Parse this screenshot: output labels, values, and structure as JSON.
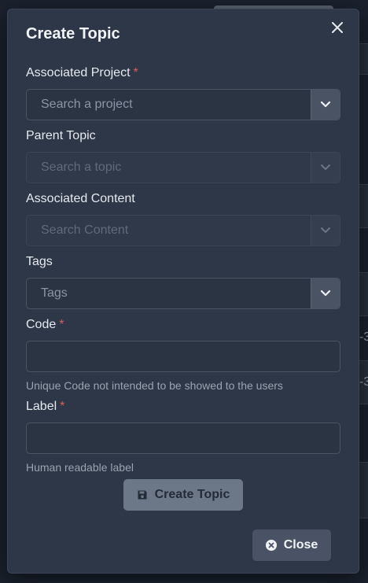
{
  "modal": {
    "title": "Create Topic",
    "close_icon": "close-icon"
  },
  "fields": {
    "project": {
      "label": "Associated Project",
      "required": "*",
      "placeholder": "Search a project"
    },
    "parent": {
      "label": "Parent Topic",
      "placeholder": "Search a topic"
    },
    "content": {
      "label": "Associated Content",
      "placeholder": "Search Content"
    },
    "tags": {
      "label": "Tags",
      "placeholder": "Tags"
    },
    "code": {
      "label": "Code",
      "required": "*",
      "value": "",
      "help": "Unique Code not intended to be showed to the users"
    },
    "label": {
      "label": "Label",
      "required": "*",
      "value": "",
      "help": "Human readable label"
    }
  },
  "buttons": {
    "create": {
      "label": "Create Topic",
      "icon": "save-icon"
    },
    "close": {
      "label": "Close",
      "icon": "close-circle-icon"
    }
  },
  "background": {
    "row_text_1": "-3",
    "row_text_2": "-3"
  },
  "colors": {
    "modal_bg": "#2d3748",
    "required": "#e05a5a",
    "create_button": "#6c7788",
    "close_button": "#4a5366"
  }
}
